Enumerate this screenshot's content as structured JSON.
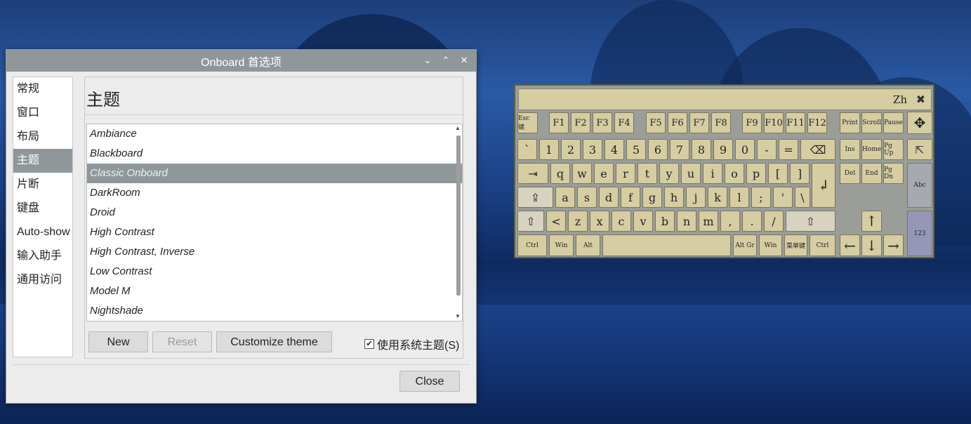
{
  "window": {
    "title": "Onboard 首选项",
    "controls": [
      "⌄",
      "⌃",
      "✕"
    ]
  },
  "sidebar": {
    "items": [
      "常规",
      "窗口",
      "布局",
      "主题",
      "片断",
      "键盘",
      "Auto-show",
      "输入助手",
      "通用访问"
    ],
    "selected": "主题"
  },
  "content": {
    "title": "主题",
    "themes": [
      "Ambiance",
      "Blackboard",
      "Classic Onboard",
      "DarkRoom",
      "Droid",
      "High Contrast",
      "High Contrast, Inverse",
      "Low Contrast",
      "Model M",
      "Nightshade"
    ],
    "selected": "Classic Onboard",
    "buttons": {
      "new": "New",
      "reset": "Reset",
      "customize": "Customize theme"
    },
    "checkbox": {
      "label": "使用系统主题(S)",
      "checked": true
    }
  },
  "footer": {
    "close": "Close"
  },
  "keyboard": {
    "bar_label": "Zh",
    "close_icon": "✖",
    "rows": {
      "fn": [
        "Esc 键",
        "F1",
        "F2",
        "F3",
        "F4",
        "F5",
        "F6",
        "F7",
        "F8",
        "F9",
        "F10",
        "F11",
        "F12",
        "Print",
        "Scroll",
        "Pause"
      ],
      "num": [
        "`",
        "1",
        "2",
        "3",
        "4",
        "5",
        "6",
        "7",
        "8",
        "9",
        "0",
        "-",
        "=",
        "⌫"
      ],
      "q": [
        "⇥",
        "q",
        "w",
        "e",
        "r",
        "t",
        "y",
        "u",
        "i",
        "o",
        "p",
        "[",
        "]",
        "↲"
      ],
      "a": [
        "⇪",
        "a",
        "s",
        "d",
        "f",
        "g",
        "h",
        "j",
        "k",
        "l",
        ";",
        "'",
        "\\"
      ],
      "z": [
        "⇧",
        "<",
        "z",
        "x",
        "c",
        "v",
        "b",
        "n",
        "m",
        ",",
        ".",
        "/",
        "⇧"
      ],
      "bottom": [
        "Ctrl",
        "Win",
        "Alt",
        "",
        "Alt Gr",
        "Win",
        "菜单键",
        "Ctrl"
      ]
    },
    "nav": {
      "ins": "Ins",
      "home": "Home",
      "pgup": "Pg Up",
      "del": "Del",
      "end": "End",
      "pgdn": "Pg Dn",
      "up": "↑",
      "left": "←",
      "down": "↓",
      "right": "→"
    },
    "side": {
      "move": "✥",
      "pointer": "⇱",
      "abc": "Abc",
      "num": "123"
    }
  }
}
